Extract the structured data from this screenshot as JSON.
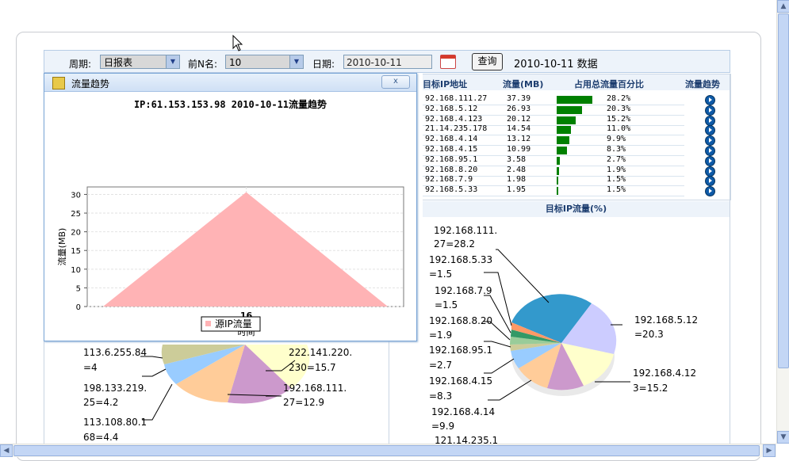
{
  "toolbar": {
    "period_label": "周期:",
    "period_value": "日报表",
    "topn_label": "前N名:",
    "topn_value": "10",
    "date_label": "日期:",
    "date_value": "2010-10-11",
    "query_button": "查询",
    "data_title": "2010-10-11 数据"
  },
  "table": {
    "headers": [
      "目标IP地址",
      "流量(MB)",
      "占用总流量百分比",
      "流量趋势"
    ],
    "rows": [
      {
        "ip": "92.168.111.27",
        "traffic": "37.39",
        "pct": "28.2%",
        "pct_value": 28.2
      },
      {
        "ip": "92.168.5.12",
        "traffic": "26.93",
        "pct": "20.3%",
        "pct_value": 20.3
      },
      {
        "ip": "92.168.4.123",
        "traffic": "20.12",
        "pct": "15.2%",
        "pct_value": 15.2
      },
      {
        "ip": "21.14.235.178",
        "traffic": "14.54",
        "pct": "11.0%",
        "pct_value": 11.0
      },
      {
        "ip": "92.168.4.14",
        "traffic": "13.12",
        "pct": "9.9%",
        "pct_value": 9.9
      },
      {
        "ip": "92.168.4.15",
        "traffic": "10.99",
        "pct": "8.3%",
        "pct_value": 8.3
      },
      {
        "ip": "92.168.95.1",
        "traffic": "3.58",
        "pct": "2.7%",
        "pct_value": 2.7
      },
      {
        "ip": "92.168.8.20",
        "traffic": "2.48",
        "pct": "1.9%",
        "pct_value": 1.9
      },
      {
        "ip": "92.168.7.9",
        "traffic": "1.98",
        "pct": "1.5%",
        "pct_value": 1.5
      },
      {
        "ip": "92.168.5.33",
        "traffic": "1.95",
        "pct": "1.5%",
        "pct_value": 1.5
      }
    ]
  },
  "right_pie": {
    "title": "目标IP流量(%)",
    "labels": [
      [
        "192.168.111.",
        "27=28.2"
      ],
      [
        "192.168.5.33",
        "=1.5"
      ],
      [
        "192.168.7.9",
        "=1.5"
      ],
      [
        "192.168.8.20",
        "=1.9"
      ],
      [
        "192.168.95.1",
        "=2.7"
      ],
      [
        "192.168.4.15",
        "=8.3"
      ],
      [
        "192.168.4.14",
        "=9.9"
      ],
      [
        "121.14.235.1",
        ""
      ],
      [
        "192.168.5.12",
        "=20.3"
      ],
      [
        "192.168.4.12",
        "3=15.2"
      ]
    ]
  },
  "left_pie": {
    "labels": [
      [
        "113.6.255.84",
        "=4"
      ],
      [
        "198.133.219.",
        "25=4.2"
      ],
      [
        "113.108.80.1",
        "68=4.4"
      ],
      [
        "222.141.220.",
        "230=15.7"
      ],
      [
        "192.168.111.",
        "27=12.9"
      ]
    ]
  },
  "popup": {
    "title": "流量趋势",
    "close_label": "x",
    "chart_title": "IP:61.153.153.98 2010-10-11流量趋势"
  },
  "chart_data": {
    "type": "area",
    "title": "IP:61.153.153.98 2010-10-11流量趋势",
    "xlabel": "时间",
    "ylabel": "流量(MB)",
    "categories": [
      "16"
    ],
    "ylim": [
      0,
      32
    ],
    "yticks": [
      0,
      5,
      10,
      15,
      20,
      25,
      30
    ],
    "series": [
      {
        "name": "源IP流量",
        "color": "#ffb3b5",
        "values": [
          30.6
        ]
      }
    ],
    "grid": true,
    "legend": "bottom"
  }
}
